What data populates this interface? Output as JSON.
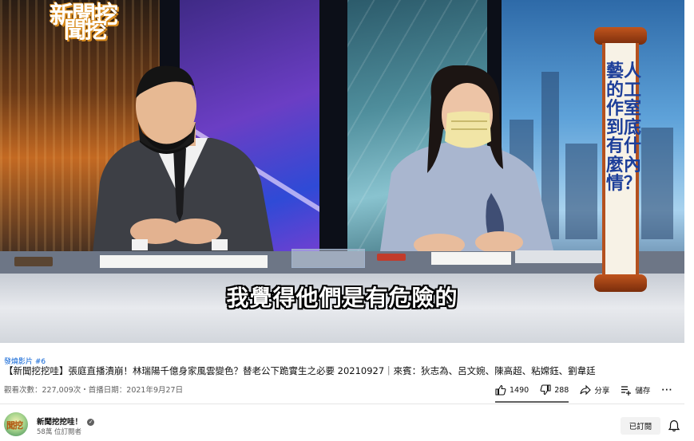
{
  "video": {
    "logo_line1": "新聞挖",
    "logo_line2": "聞挖",
    "subtitle": "我覺得他們是有危險的",
    "banner_text": "藝人的工作室　到底有什麼內情？"
  },
  "hashtag": "發燒影片 #6",
  "title": "【新聞挖挖哇】張庭直播潰崩！林瑞陽千億身家風雲變色？替老公下跪實生之必要 20210927｜來賓：狄志為、呂文婉、陳高超、粘嫦鈺、劉韋廷",
  "views_text": "觀看次數：227,009次・首播日期：2021年9月27日",
  "actions": {
    "like_count": "1490",
    "dislike_count": "288",
    "share_label": "分享",
    "save_label": "儲存",
    "more_label": "···"
  },
  "channel": {
    "name": "新聞挖挖哇！",
    "avatar_text": "聞挖",
    "subscribers": "58萬 位訂閱者",
    "subscribe_label": "已訂閱"
  },
  "colors": {
    "link_blue": "#065fd4",
    "banner_text": "#1d3f9a",
    "banner_frame": "#b4511f"
  }
}
